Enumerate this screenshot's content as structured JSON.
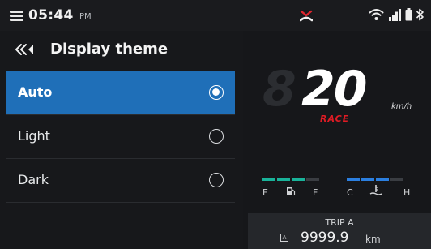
{
  "status_bar": {
    "time": "05:44",
    "ampm": "PM",
    "icons": [
      "menu-icon",
      "alert-icon",
      "wifi-icon",
      "signal-icon",
      "battery-icon",
      "bluetooth-icon"
    ],
    "alert_color": "#e0262f"
  },
  "panel": {
    "title": "Display theme",
    "back_icon": "chevron-back-icon",
    "options": [
      {
        "label": "Auto",
        "selected": true
      },
      {
        "label": "Light",
        "selected": false
      },
      {
        "label": "Dark",
        "selected": false
      }
    ],
    "accent": "#1f6fb8"
  },
  "cluster": {
    "speed": "20",
    "ghost_digit": "8",
    "unit": "km/h",
    "mode": "RACE",
    "mode_color": "#e01b24",
    "fuel": {
      "low": "E",
      "high": "F",
      "icon": "fuel-pump-icon",
      "color": "#19b39a"
    },
    "temp": {
      "low": "C",
      "high": "H",
      "icon": "coolant-temp-icon",
      "color": "#2b7fe0"
    },
    "trip": {
      "label": "TRIP A",
      "value": "9999.9",
      "unit": "km",
      "icon_text": "A"
    }
  }
}
